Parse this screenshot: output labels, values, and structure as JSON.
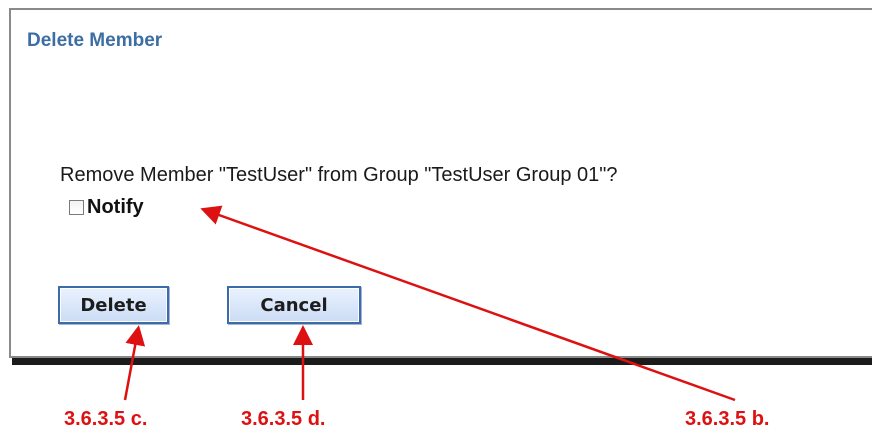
{
  "dialog": {
    "title": "Delete Member",
    "prompt": "Remove Member \"TestUser\" from Group \"TestUser Group 01\"?",
    "notify_label": "Notify",
    "notify_checked": false,
    "delete_label": "Delete",
    "cancel_label": "Cancel"
  },
  "annotations": {
    "delete_ref": "3.6.3.5 c.",
    "cancel_ref": "3.6.3.5 d.",
    "notify_ref": "3.6.3.5 b.",
    "color": "#dd1111"
  }
}
